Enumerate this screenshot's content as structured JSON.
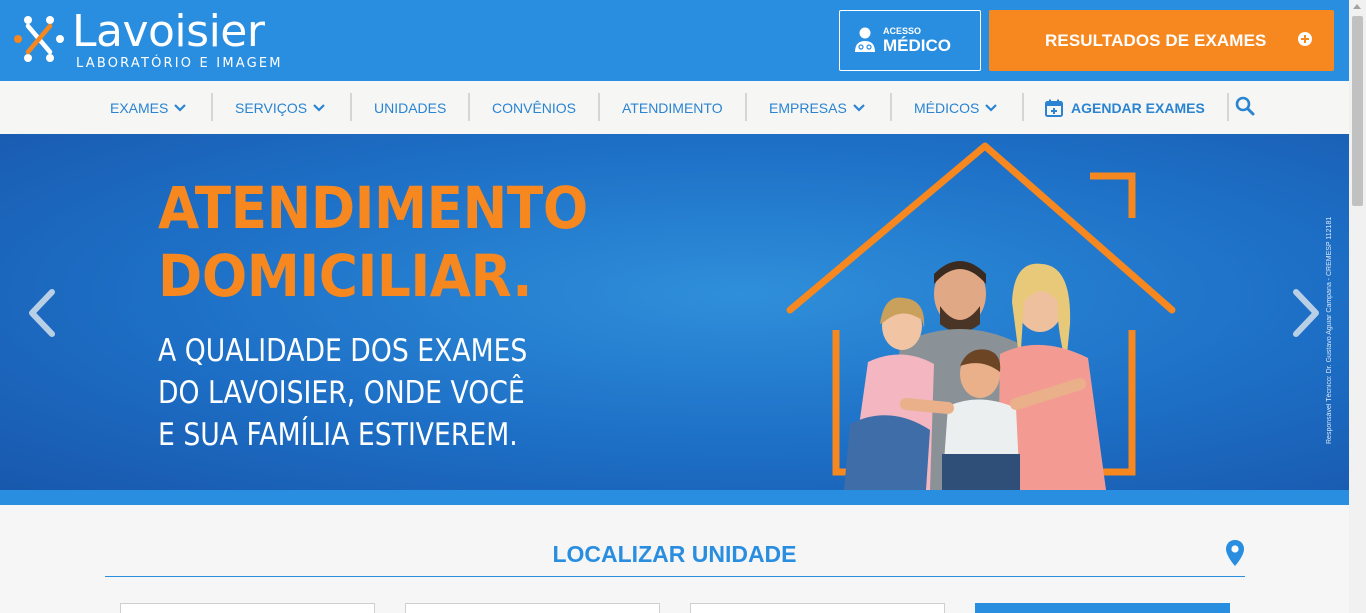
{
  "header": {
    "logo_name": "Lavoisier",
    "logo_sub": "LABORATÓRIO E IMAGEM",
    "medico_small": "ACESSO",
    "medico_big": "MÉDICO",
    "results_label": "RESULTADOS DE EXAMES"
  },
  "nav": {
    "items": [
      {
        "label": "EXAMES",
        "dropdown": true
      },
      {
        "label": "SERVIÇOS",
        "dropdown": true
      },
      {
        "label": "UNIDADES",
        "dropdown": false
      },
      {
        "label": "CONVÊNIOS",
        "dropdown": false
      },
      {
        "label": "ATENDIMENTO",
        "dropdown": false
      },
      {
        "label": "EMPRESAS",
        "dropdown": true
      },
      {
        "label": "MÉDICOS",
        "dropdown": true
      },
      {
        "label": "AGENDAR EXAMES",
        "dropdown": false
      }
    ]
  },
  "hero": {
    "title_line1": "ATENDIMENTO",
    "title_line2": "DOMICILIAR.",
    "sub_line1": "A QUALIDADE DOS EXAMES",
    "sub_line2": "DO LAVOISIER, ONDE VOCÊ",
    "sub_line3": "E SUA FAMÍLIA ESTIVEREM.",
    "responsible": "Responsável Técnico: Dr. Gustavo Aguiar Campana - CREMESP 112181"
  },
  "section": {
    "title": "LOCALIZAR UNIDADE"
  },
  "colors": {
    "brand_blue": "#2a8ee0",
    "brand_orange": "#f7871f",
    "nav_text": "#2a84d2"
  },
  "icons": {
    "logo": "lavoisier-logo-mark",
    "medico": "doctor-icon",
    "results": "plus-circle-icon",
    "dropdown": "chevron-down-icon",
    "agendar": "calendar-plus-icon",
    "search": "search-icon",
    "carousel_prev": "chevron-left-icon",
    "carousel_next": "chevron-right-icon",
    "location": "map-pin-icon"
  }
}
